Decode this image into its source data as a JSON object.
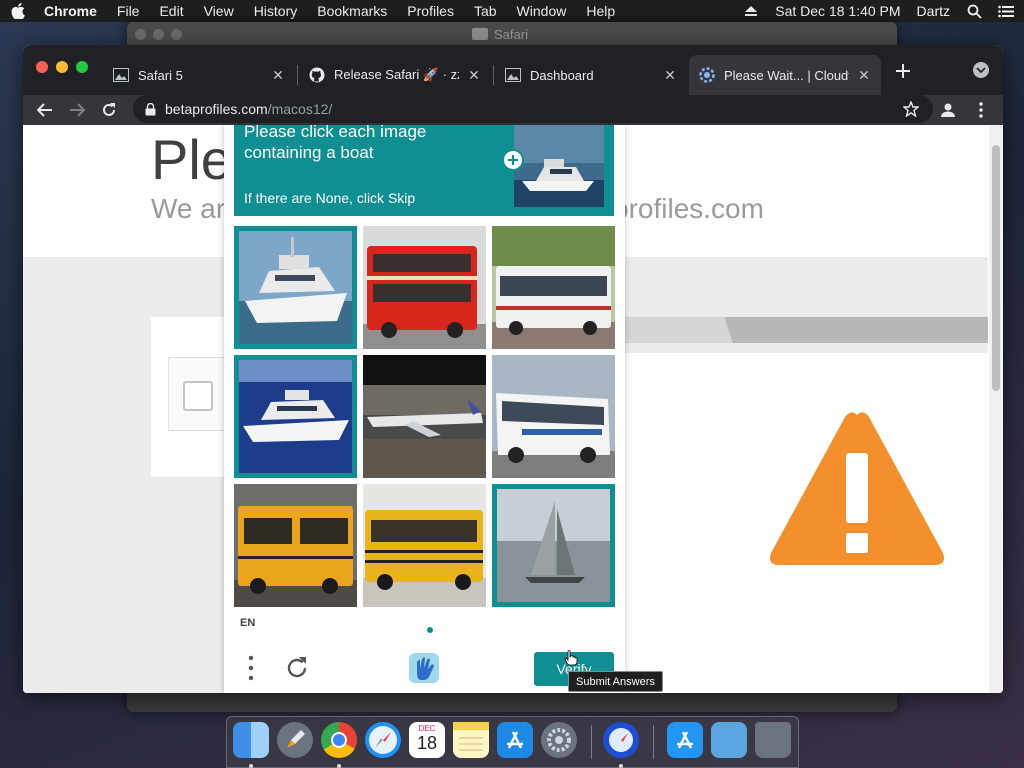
{
  "menubar": {
    "app": "Chrome",
    "items": [
      "File",
      "Edit",
      "View",
      "History",
      "Bookmarks",
      "Profiles",
      "Tab",
      "Window",
      "Help"
    ],
    "datetime": "Sat Dec 18  1:40 PM",
    "user": "Dartz"
  },
  "background_window": {
    "title": "Safari"
  },
  "chrome": {
    "tabs": [
      {
        "label": "Safari 5",
        "icon": "image-icon"
      },
      {
        "label": "Release Safari 🚀 · zza",
        "icon": "github-icon"
      },
      {
        "label": "Dashboard",
        "icon": "image-icon"
      },
      {
        "label": "Please Wait... | Cloudfla",
        "icon": "cloudflare-gear-icon",
        "active": true
      }
    ],
    "url_host": "betaprofiles.com",
    "url_path": "/macos12/"
  },
  "page": {
    "heading": "Ple",
    "subheading_left": "We ar",
    "subheading_right": "profiles.com"
  },
  "captcha": {
    "prompt_line": "Please click each image containing a boat",
    "prompt_hint": "If there are None, click Skip",
    "tiles": [
      {
        "subject": "white yacht at dock",
        "selected": true
      },
      {
        "subject": "red double-decker bus",
        "selected": false
      },
      {
        "subject": "articulated city bus",
        "selected": false
      },
      {
        "subject": "white yacht at sea",
        "selected": true
      },
      {
        "subject": "airplane on runway",
        "selected": false
      },
      {
        "subject": "white coach bus",
        "selected": false
      },
      {
        "subject": "yellow bus",
        "selected": false
      },
      {
        "subject": "yellow school bus",
        "selected": false
      },
      {
        "subject": "sailboat on water",
        "selected": true
      }
    ],
    "language": "EN",
    "verify_label": "Verify",
    "tooltip": "Submit Answers",
    "accent": "#108f93"
  },
  "dock": {
    "apps": [
      "Finder",
      "Launchpad",
      "Google Chrome",
      "Safari",
      "Calendar",
      "Notes",
      "App Store",
      "System Preferences",
      "Safari Technology Preview",
      "App Store",
      "Downloads",
      "Trash"
    ],
    "calendar": {
      "month": "DEC",
      "day": "18"
    }
  }
}
